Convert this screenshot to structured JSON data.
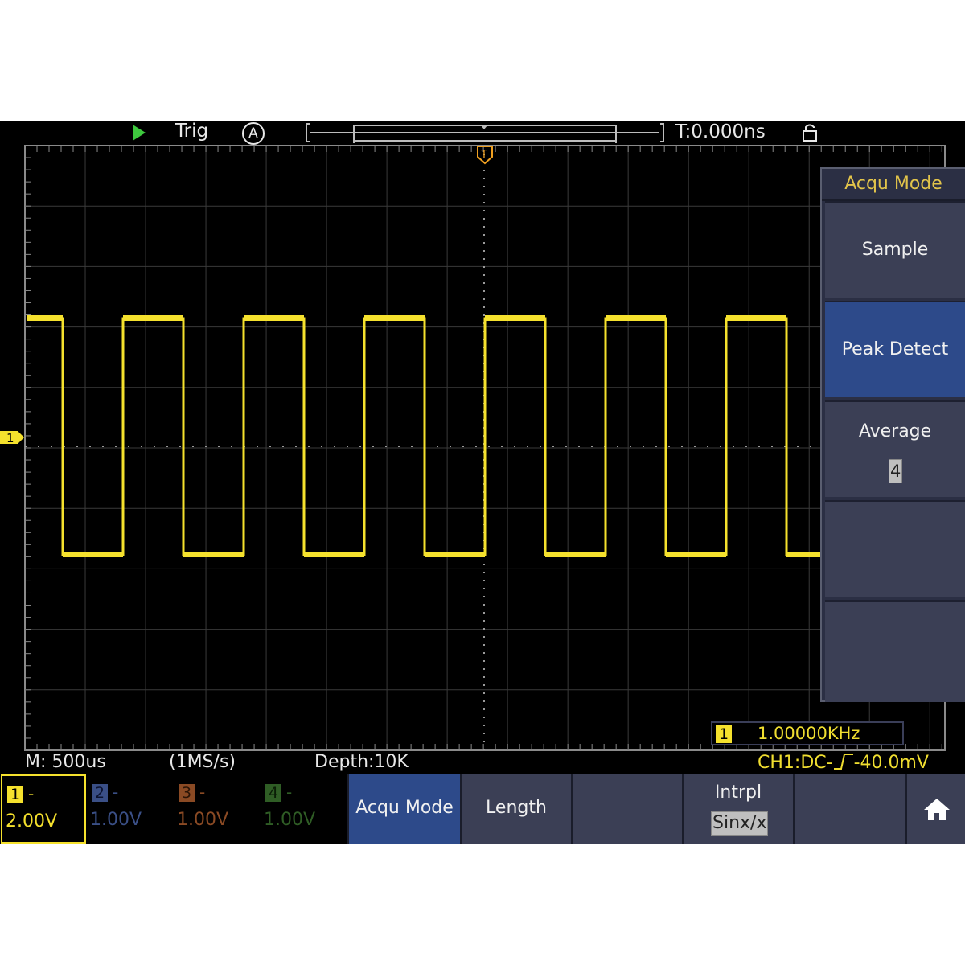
{
  "status": {
    "trigger_state": "Trig",
    "trigger_mode": "A",
    "trigger_position": "T:0.000ns"
  },
  "side_menu": {
    "title": "Acqu Mode",
    "items": [
      {
        "label": "Sample",
        "active": false
      },
      {
        "label": "Peak Detect",
        "active": true
      },
      {
        "label": "Average",
        "value": "4",
        "active": false
      }
    ]
  },
  "frequency": {
    "channel": "1",
    "value": "1.00000KHz"
  },
  "timebase": {
    "main": "M: 500us",
    "sample_rate": "(1MS/s)",
    "depth": "Depth:10K"
  },
  "trigger_info": {
    "prefix": "CH1:DC-",
    "level": "-40.0mV"
  },
  "channels": [
    {
      "num": "1",
      "coupling": "-",
      "volts": "2.00V",
      "color": "#f5e12d"
    },
    {
      "num": "2",
      "coupling": "-",
      "volts": "1.00V",
      "color": "#3a4f86"
    },
    {
      "num": "3",
      "coupling": "-",
      "volts": "1.00V",
      "color": "#8a4a24"
    },
    {
      "num": "4",
      "coupling": "-",
      "volts": "1.00V",
      "color": "#2f5d25"
    }
  ],
  "bottom_menu": [
    {
      "label": "Acqu Mode",
      "active": true
    },
    {
      "label": "Length",
      "active": false
    },
    {
      "label": "",
      "active": false
    },
    {
      "label": "Intrpl",
      "value": "Sinx/x",
      "active": false
    },
    {
      "label": "",
      "active": false
    }
  ],
  "colors": {
    "ch1": "#f5e12d",
    "menu_bg": "#3b3f55",
    "menu_active": "#2d4a8a",
    "title_text": "#e2c44a"
  },
  "icons": {
    "run": "play-triangle-icon",
    "lock": "lock-icon",
    "home": "home-icon",
    "trigger_marker": "trigger-T-icon",
    "channel_marker": "ch1-offset-icon"
  }
}
